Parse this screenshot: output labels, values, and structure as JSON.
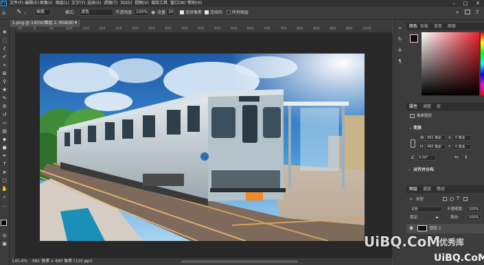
{
  "menubar": {
    "logo": "Ps",
    "items": [
      "文件(F)",
      "编辑(E)",
      "图像(I)",
      "图层(L)",
      "文字(Y)",
      "选择(S)",
      "滤镜(T)",
      "3D(D)",
      "视图(V)",
      "增效工具",
      "窗口(W)",
      "帮助(H)"
    ],
    "minimize": "–",
    "maximize": "□",
    "close": "✕"
  },
  "options": {
    "preset": "画笔",
    "mode_label": "模式:",
    "mode_value": "滤色",
    "opacity_label": "不透明度:",
    "opacity_value": "100%",
    "flow_label": "流量:",
    "flow_value": "30",
    "check_label_1": "连续像素",
    "check_label_2": "连续的",
    "check_label_3": "所有图层",
    "search_icon": "search-icon",
    "workspace_icon": "workspace-icon",
    "share_icon": "share-icon"
  },
  "document": {
    "tab_title": "1.png @ 145%(图层 2, RGB/8) *",
    "tab_close": "×",
    "zoom": "145.4%",
    "doc_info": "981 像素 x 490 像素 (120 ppi)",
    "status_arrow": "›"
  },
  "ruler": {
    "top_ticks": [
      "50",
      "0",
      "50",
      "100",
      "150",
      "200",
      "250",
      "300",
      "350",
      "400",
      "450",
      "500",
      "550",
      "600",
      "650",
      "700",
      "750",
      "800",
      "850",
      "900",
      "950",
      "1000"
    ]
  },
  "color_panel": {
    "tabs": [
      "颜色",
      "色板",
      "渐变",
      "图案"
    ],
    "fg_color": "#1a0a0a",
    "hue_color": "#e8212e"
  },
  "properties_panel": {
    "tabs": [
      "属性",
      "调整",
      "库"
    ],
    "layer_type": "像素图层",
    "transform_header": "变换",
    "w_label": "W",
    "w_value": "981 像素",
    "h_label": "H",
    "h_value": "490 像素",
    "x_label": "X",
    "x_value": "0 像素",
    "y_label": "Y",
    "y_value": "0 像素",
    "angle_value": "0.00°",
    "align_header": "对齐并分布"
  },
  "layers_panel": {
    "tabs": [
      "图层",
      "通道",
      "路径"
    ],
    "kind_label": "类型",
    "blend_mode": "滤色",
    "opacity_label": "不透明度:",
    "opacity_value": "100%",
    "lock_label": "锁定:",
    "fill_label": "填充:",
    "fill_value": "100%",
    "layer_name": "图层 2"
  },
  "watermark": {
    "text_left": "UiBQ.CoM",
    "text_right": "UiBQ.CoM",
    "overlay": "优秀库"
  }
}
